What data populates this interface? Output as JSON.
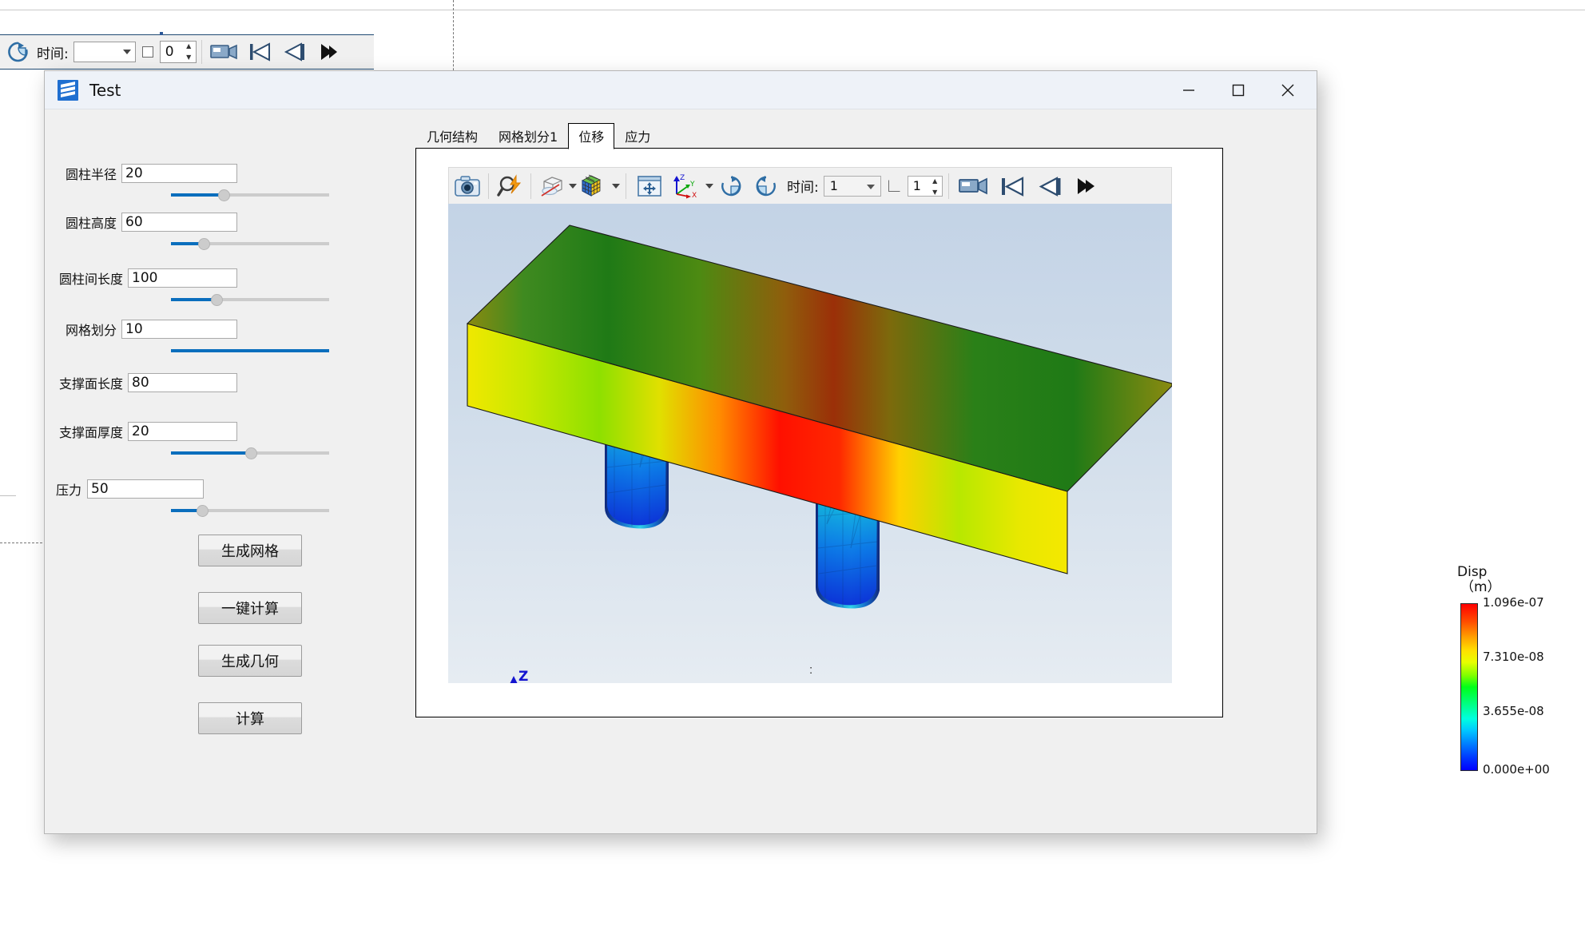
{
  "host": {
    "time_label": "时间:",
    "combo_value": "",
    "checkbox_checked": false,
    "spin_value": "0",
    "icons": [
      "refresh-rotate-icon",
      "camera-record-icon",
      "skip-first-icon",
      "step-back-icon",
      "play-fast-icon"
    ]
  },
  "window": {
    "title": "Test",
    "icon": "app-stack-icon",
    "minimize": "minimize-icon",
    "maximize": "maximize-icon",
    "close": "close-icon"
  },
  "sidebar": {
    "controls": [
      {
        "label": "圆柱半径",
        "value": "20",
        "slider_pct": 34,
        "slider_visible": true
      },
      {
        "label": "圆柱高度",
        "value": "60",
        "slider_pct": 20,
        "slider_visible": true
      },
      {
        "label": "圆柱间长度",
        "value": "100",
        "slider_pct": 29,
        "slider_visible": true
      },
      {
        "label": "网格划分",
        "value": "10",
        "slider_pct": 100,
        "slider_visible": false
      },
      {
        "label": "支撑面长度",
        "value": "80",
        "slider_pct": 0,
        "slider_visible": false
      },
      {
        "label": "支撑面厚度",
        "value": "20",
        "slider_pct": 50,
        "slider_visible": true
      },
      {
        "label": "压力",
        "value": "50",
        "slider_pct": 19,
        "slider_visible": true
      }
    ],
    "buttons": [
      {
        "label": "生成网格"
      },
      {
        "label": "一键计算"
      },
      {
        "label": "生成几何"
      },
      {
        "label": "计算"
      }
    ]
  },
  "tabs": [
    {
      "label": "几何结构",
      "selected": false
    },
    {
      "label": "网格划分1",
      "selected": false
    },
    {
      "label": "位移",
      "selected": true
    },
    {
      "label": "应力",
      "selected": false
    }
  ],
  "vtk_toolbar": {
    "time_label": "时间:",
    "time_combo_value": "1",
    "checkbox_checked": false,
    "frame_spin_value": "1",
    "icons": [
      "camera-snapshot-icon",
      "magnifier-lightning-icon",
      "surface-hidden-icon",
      "color-cube-icon",
      "fit-to-window-icon",
      "axes-orientation-icon",
      "rotate-cw-icon",
      "rotate-ccw-icon",
      "record-video-icon",
      "skip-first-icon",
      "step-back-icon",
      "play-fast-icon"
    ]
  },
  "viewport": {
    "axes": {
      "x": "X",
      "y": "Y",
      "z": "Z"
    },
    "status_marker": ":"
  },
  "legend": {
    "title_line1": "Disp",
    "title_line2": "（m）",
    "max": "1.096e-07",
    "mid_high": "7.310e-08",
    "mid_low": "3.655e-08",
    "min": "0.000e+00"
  },
  "colors": {
    "accent_blue": "#0a6ebd",
    "title_icon": "#1f6fd0",
    "viewport_top": "#c3d3e6",
    "legend_max": "#ff0000",
    "legend_min": "#0000ff"
  }
}
